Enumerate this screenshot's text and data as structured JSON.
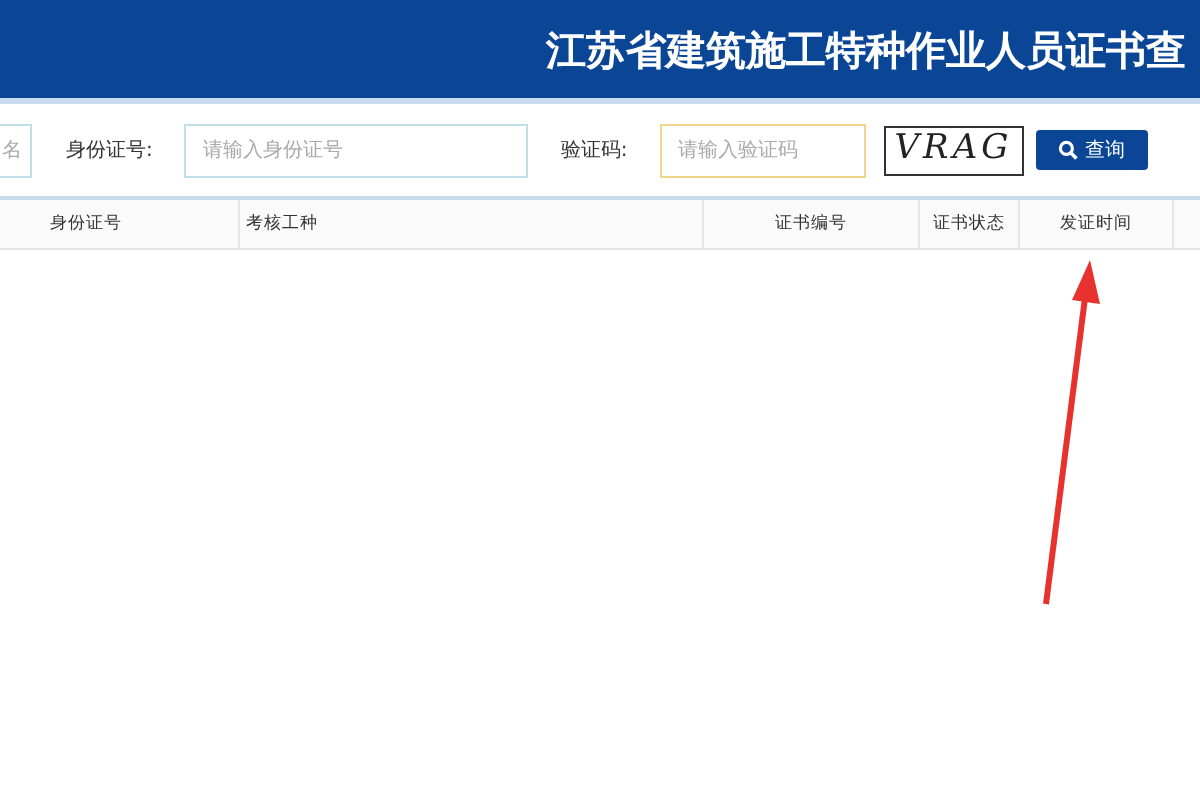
{
  "header": {
    "title": "江苏省建筑施工特种作业人员证书查"
  },
  "search": {
    "fields": [
      {
        "placeholder": "名",
        "kind": "cut"
      },
      {
        "label": "身份证号:",
        "placeholder": "请输入身份证号",
        "kind": "plain"
      },
      {
        "label": "验证码:",
        "placeholder": "请输入验证码",
        "kind": "captcha"
      }
    ],
    "captcha_text": "VRAG",
    "button": "查询"
  },
  "table": {
    "columns": [
      "身份证号",
      "考核工种",
      "证书编号",
      "证书状态",
      "发证时间"
    ]
  }
}
